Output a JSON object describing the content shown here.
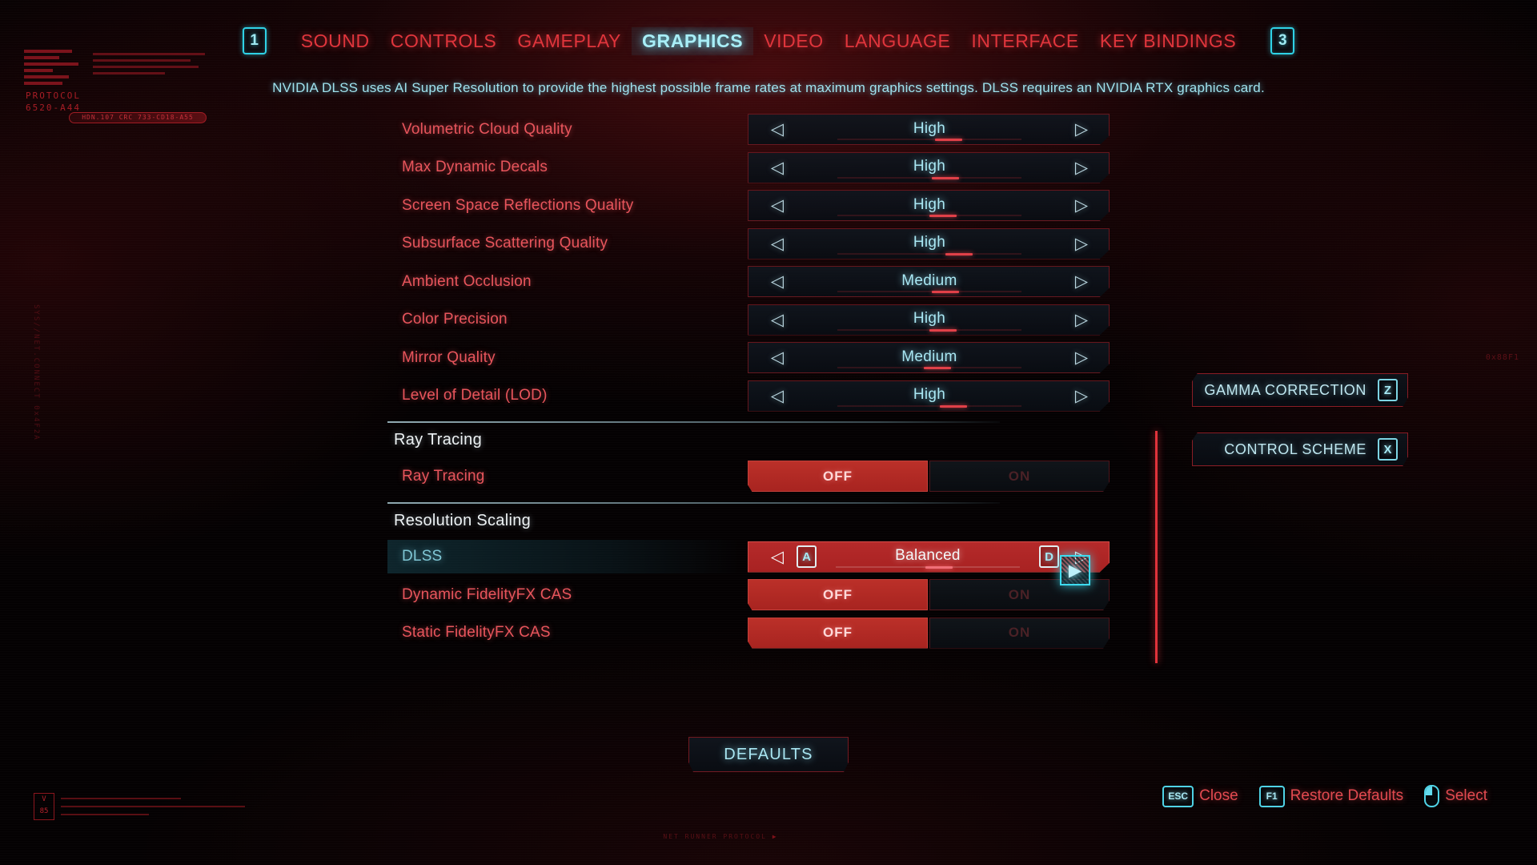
{
  "header": {
    "page_key_left": "1",
    "page_key_right": "3",
    "tabs": [
      {
        "label": "SOUND",
        "active": false
      },
      {
        "label": "CONTROLS",
        "active": false
      },
      {
        "label": "GAMEPLAY",
        "active": false
      },
      {
        "label": "GRAPHICS",
        "active": true
      },
      {
        "label": "VIDEO",
        "active": false
      },
      {
        "label": "LANGUAGE",
        "active": false
      },
      {
        "label": "INTERFACE",
        "active": false
      },
      {
        "label": "KEY BINDINGS",
        "active": false
      }
    ]
  },
  "description": "NVIDIA DLSS uses AI Super Resolution to provide the highest possible frame rates at maximum graphics settings. DLSS requires an NVIDIA RTX graphics card.",
  "settings": {
    "quality_rows": [
      {
        "label": "Volumetric Cloud Quality",
        "value": "High",
        "tick_pct": 58
      },
      {
        "label": "Max Dynamic Decals",
        "value": "High",
        "tick_pct": 57
      },
      {
        "label": "Screen Space Reflections Quality",
        "value": "High",
        "tick_pct": 56
      },
      {
        "label": "Subsurface Scattering Quality",
        "value": "High",
        "tick_pct": 62
      },
      {
        "label": "Ambient Occlusion",
        "value": "Medium",
        "tick_pct": 57
      },
      {
        "label": "Color Precision",
        "value": "High",
        "tick_pct": 56
      },
      {
        "label": "Mirror Quality",
        "value": "Medium",
        "tick_pct": 54
      },
      {
        "label": "Level of Detail (LOD)",
        "value": "High",
        "tick_pct": 60
      }
    ],
    "ray_tracing_section": {
      "title": "Ray Tracing",
      "rows": [
        {
          "label": "Ray Tracing",
          "off_label": "OFF",
          "on_label": "ON",
          "state": "OFF"
        }
      ]
    },
    "resolution_scaling_section": {
      "title": "Resolution Scaling",
      "dlss": {
        "label": "DLSS",
        "value": "Balanced",
        "left_key": "A",
        "right_key": "D",
        "tick_pct": 55
      },
      "rows": [
        {
          "label": "Dynamic FidelityFX CAS",
          "off_label": "OFF",
          "on_label": "ON",
          "state": "OFF"
        },
        {
          "label": "Static FidelityFX CAS",
          "off_label": "OFF",
          "on_label": "ON",
          "state": "OFF"
        }
      ]
    }
  },
  "side_buttons": [
    {
      "label": "GAMMA CORRECTION",
      "key": "Z"
    },
    {
      "label": "CONTROL SCHEME",
      "key": "X"
    }
  ],
  "defaults_button": {
    "label": "DEFAULTS"
  },
  "hints": [
    {
      "key": "ESC",
      "label": "Close",
      "icon": "key-icon"
    },
    {
      "key": "F1",
      "label": "Restore Defaults",
      "icon": "key-icon"
    },
    {
      "key": "",
      "label": "Select",
      "icon": "mouse-icon"
    }
  ],
  "cursor": {
    "glyph": "▶"
  },
  "decorations": {
    "protocol_line1": "PROTOCOL",
    "protocol_line2": "6520-A44",
    "pill_text": "HDN.107 CRC 733-CD18-A55",
    "vbox_line1": "V",
    "vbox_line2": "85",
    "side_left_text": "SYS//NET.CONNECT 0x4F2A",
    "side_right_text": "0x88F1",
    "bottom_center_text": "NET RUNNER PROTOCOL"
  },
  "colors": {
    "accent_red": "#e0353c",
    "accent_cyan": "#a9e7f3",
    "toggle_red": "#b52a2a",
    "cursor_cyan": "#3ddcef",
    "background": "#040102"
  }
}
